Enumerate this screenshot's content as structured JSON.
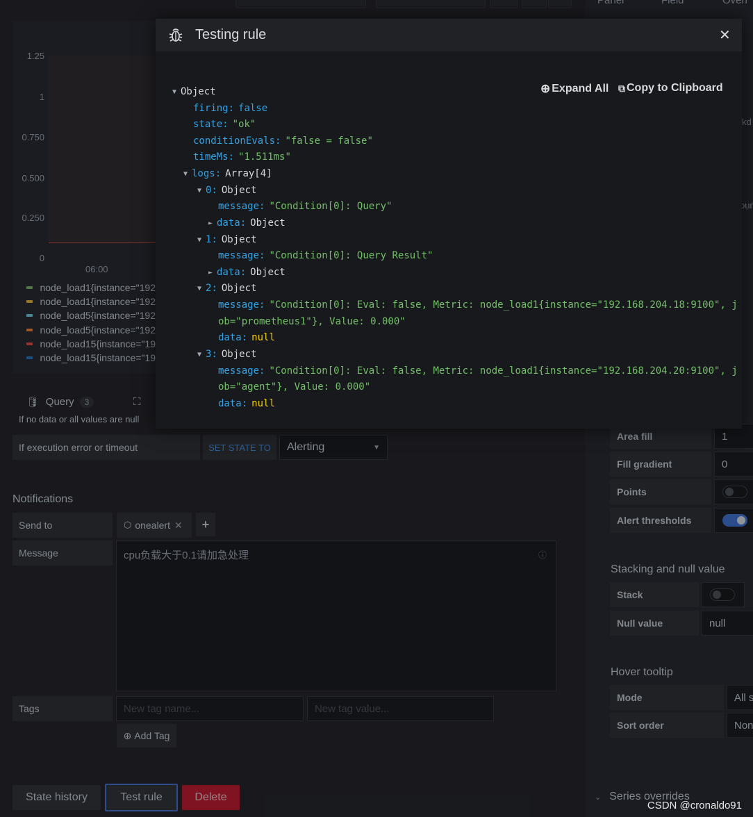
{
  "right_tabs": [
    "Panel",
    "Field",
    "Overr"
  ],
  "chart": {
    "y_ticks": [
      "1.25",
      "1",
      "0.750",
      "0.500",
      "0.250",
      "0"
    ],
    "x_ticks": [
      "06:00"
    ],
    "legend": [
      {
        "label": "node_load1{instance=\"192",
        "color": "#7eb26d"
      },
      {
        "label": "node_load1{instance=\"192",
        "color": "#eab839"
      },
      {
        "label": "node_load5{instance=\"192",
        "color": "#6ed0e0"
      },
      {
        "label": "node_load5{instance=\"192",
        "color": "#ef843c"
      },
      {
        "label": "node_load15{instance=\"19",
        "color": "#e24d42"
      },
      {
        "label": "node_load15{instance=\"19",
        "color": "#1f78c1"
      }
    ]
  },
  "query_tab": {
    "label": "Query",
    "count": "3"
  },
  "no_data_row": "If no data or all values are null",
  "exec_error": {
    "label": "If execution error or timeout",
    "set_state": "SET STATE TO",
    "value": "Alerting"
  },
  "notifications": {
    "heading": "Notifications",
    "send_to_label": "Send to",
    "channel": "onealert",
    "message_label": "Message",
    "message_value": "cpu负载大于0.1请加急处理",
    "tags_label": "Tags",
    "tag_name_placeholder": "New tag name...",
    "tag_value_placeholder": "New tag value...",
    "add_tag": "Add Tag"
  },
  "bottom_buttons": {
    "state_history": "State history",
    "test_rule": "Test rule",
    "delete": "Delete"
  },
  "right_panel": {
    "area_fill": {
      "label": "Area fill",
      "value": "1"
    },
    "fill_gradient": {
      "label": "Fill gradient",
      "value": "0"
    },
    "points": {
      "label": "Points",
      "on": false
    },
    "alert_thresholds": {
      "label": "Alert thresholds",
      "on": true
    },
    "stacking_heading": "Stacking and null value",
    "stack": {
      "label": "Stack",
      "on": false
    },
    "null_value": {
      "label": "Null value",
      "value": "null"
    },
    "hover_heading": "Hover tooltip",
    "mode": {
      "label": "Mode",
      "value": "All s"
    },
    "sort_order": {
      "label": "Sort order",
      "value": "Non"
    },
    "series_overrides": "Series overrides",
    "partial_right_texts": [
      "kd",
      "oun"
    ]
  },
  "modal": {
    "title": "Testing rule",
    "expand_all": "Expand All",
    "copy": "Copy to Clipboard",
    "json_lines": [
      {
        "indent": 0,
        "arrow": "▼",
        "key": "Object",
        "key_class": "t"
      },
      {
        "indent": 1,
        "key": "firing",
        "value": "false",
        "value_class": "k"
      },
      {
        "indent": 1,
        "key": "state",
        "value": "\"ok\"",
        "value_class": "s"
      },
      {
        "indent": 1,
        "key": "conditionEvals",
        "value": "\"false = false\"",
        "value_class": "s"
      },
      {
        "indent": 1,
        "key": "timeMs",
        "value": "\"1.511ms\"",
        "value_class": "s"
      },
      {
        "indent": 1,
        "arrow": "▼",
        "key": "logs",
        "value": "Array[4]",
        "value_class": "t"
      },
      {
        "indent": 2,
        "arrow": "▼",
        "key": "0",
        "value": "Object",
        "value_class": "t"
      },
      {
        "indent": 3,
        "key": "message",
        "value": "\"Condition[0]: Query\"",
        "value_class": "s"
      },
      {
        "indent": 3,
        "arrow": "►",
        "key": "data",
        "value": "Object",
        "value_class": "t"
      },
      {
        "indent": 2,
        "arrow": "▼",
        "key": "1",
        "value": "Object",
        "value_class": "t"
      },
      {
        "indent": 3,
        "key": "message",
        "value": "\"Condition[0]: Query Result\"",
        "value_class": "s"
      },
      {
        "indent": 3,
        "arrow": "►",
        "key": "data",
        "value": "Object",
        "value_class": "t"
      },
      {
        "indent": 2,
        "arrow": "▼",
        "key": "2",
        "value": "Object",
        "value_class": "t"
      },
      {
        "indent": 3,
        "key": "message",
        "value": "\"Condition[0]: Eval: false, Metric: node_load1{instance=\"192.168.204.18:9100\", j",
        "value_class": "s"
      },
      {
        "indent": 3,
        "cont": true,
        "value": "ob=\"prometheus1\"}, Value: 0.000\"",
        "value_class": "s"
      },
      {
        "indent": 3,
        "key": "data",
        "value": "null",
        "value_class": "n"
      },
      {
        "indent": 2,
        "arrow": "▼",
        "key": "3",
        "value": "Object",
        "value_class": "t"
      },
      {
        "indent": 3,
        "key": "message",
        "value": "\"Condition[0]: Eval: false, Metric: node_load1{instance=\"192.168.204.20:9100\", j",
        "value_class": "s"
      },
      {
        "indent": 3,
        "cont": true,
        "value": "ob=\"agent\"}, Value: 0.000\"",
        "value_class": "s"
      },
      {
        "indent": 3,
        "key": "data",
        "value": "null",
        "value_class": "n"
      }
    ]
  },
  "watermark": "CSDN @cronaldo91"
}
